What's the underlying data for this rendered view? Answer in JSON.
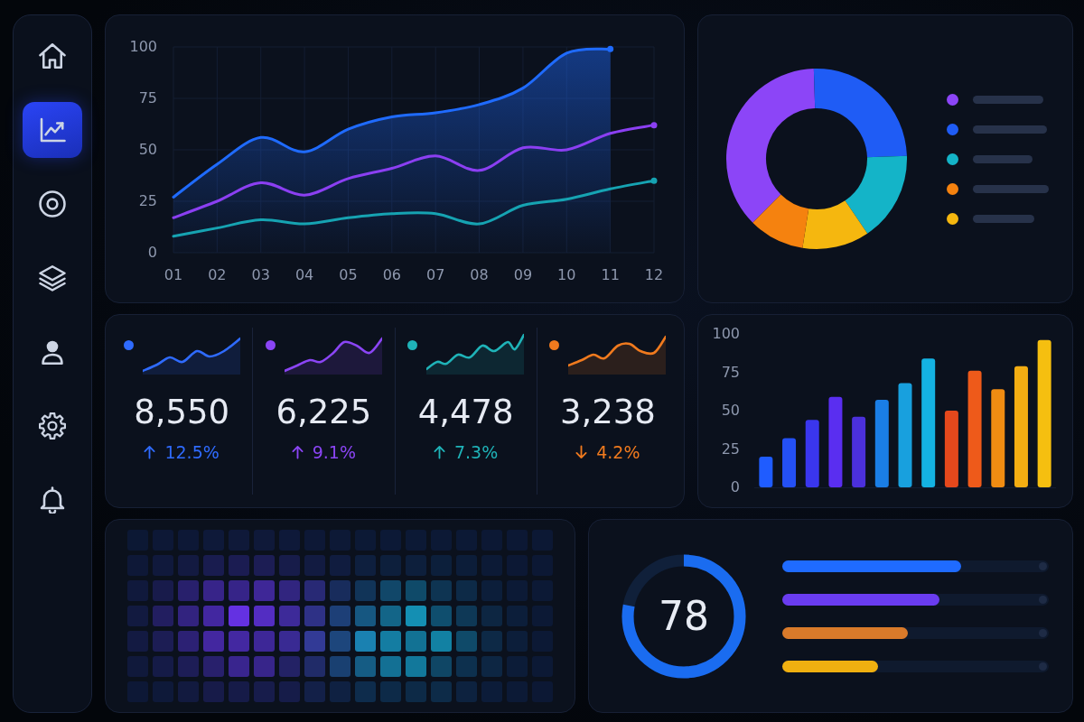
{
  "sidebar": {
    "items": [
      {
        "kind": "home",
        "selected": false
      },
      {
        "kind": "chart",
        "selected": true
      },
      {
        "kind": "target",
        "selected": false
      },
      {
        "kind": "layers",
        "selected": false
      },
      {
        "kind": "user",
        "selected": false
      },
      {
        "kind": "settings",
        "selected": false
      },
      {
        "kind": "notifications",
        "selected": false
      }
    ]
  },
  "trend_chart": {
    "chart_data": {
      "type": "line",
      "categories": [
        "01",
        "02",
        "03",
        "04",
        "05",
        "06",
        "07",
        "08",
        "09",
        "10",
        "11",
        "12"
      ],
      "ylim": [
        0,
        100
      ],
      "yticks": [
        0,
        25,
        50,
        75,
        100
      ],
      "grid": true,
      "series": [
        {
          "type": "area",
          "color": "#1f6bff",
          "values": [
            27,
            43,
            56,
            49,
            60,
            66,
            68,
            72,
            80,
            97,
            99,
            null
          ]
        },
        {
          "type": "line",
          "color": "#8b3ff2",
          "values": [
            17,
            25,
            34,
            28,
            36,
            41,
            47,
            40,
            51,
            50,
            58,
            62
          ]
        },
        {
          "type": "line",
          "color": "#16a3b2",
          "values": [
            8,
            12,
            16,
            14,
            17,
            19,
            19,
            14,
            23,
            26,
            31,
            35
          ]
        }
      ]
    }
  },
  "breakdown": {
    "chart_data": {
      "type": "donut",
      "values": [
        37,
        25,
        16,
        12,
        10
      ],
      "colors": [
        "#8c45f7",
        "#1f5cf5",
        "#14b4c8",
        "#f5b70f",
        "#f5820f"
      ]
    },
    "legend": [
      {
        "color": "#8c45f7"
      },
      {
        "color": "#1f5cf5"
      },
      {
        "color": "#14b4c8"
      },
      {
        "color": "#f5820f"
      },
      {
        "color": "#f5b70f"
      }
    ]
  },
  "kpis": [
    {
      "color": "#2f6bff",
      "value": "8,550",
      "change": "12.5%",
      "kind": "up"
    },
    {
      "color": "#8b45f5",
      "value": "6,225",
      "change": "9.1%",
      "kind": "up"
    },
    {
      "color": "#1fb3b8",
      "value": "4,478",
      "change": "7.3%",
      "kind": "up"
    },
    {
      "color": "#f07a1e",
      "value": "3,238",
      "change": "4.2%",
      "kind": "down"
    }
  ],
  "bar_chart": {
    "chart_data": {
      "type": "bar",
      "orientation": "vertical",
      "categories": [
        null,
        null,
        null,
        null,
        null,
        null,
        null,
        null,
        null,
        null,
        null,
        null,
        null
      ],
      "ylim": [
        0,
        100
      ],
      "yticks": [
        0,
        25,
        50,
        75,
        100
      ],
      "series": [
        {
          "values": [
            20,
            32,
            44,
            59,
            46,
            57,
            68,
            84,
            50,
            76,
            64,
            79,
            96
          ]
        }
      ]
    }
  },
  "score": {
    "value": "78",
    "level": 0.78
  },
  "progress": [
    {
      "color": "#1f6bff",
      "level": 0.67
    },
    {
      "color": "#6a3cf0",
      "level": 0.59
    },
    {
      "color": "#d97a2a",
      "level": 0.47
    },
    {
      "color": "#f0b010",
      "level": 0.36
    }
  ]
}
